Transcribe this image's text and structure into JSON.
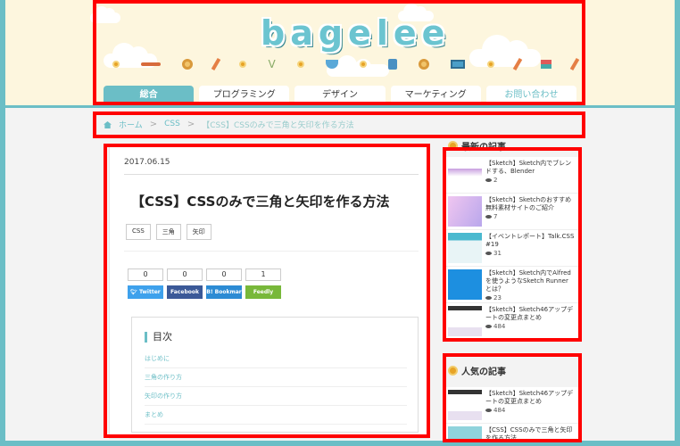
{
  "site": {
    "logo": "bagelee"
  },
  "nav": {
    "items": [
      {
        "label": "総合"
      },
      {
        "label": "プログラミング"
      },
      {
        "label": "デザイン"
      },
      {
        "label": "マーケティング"
      },
      {
        "label": "お問い合わせ"
      }
    ]
  },
  "breadcrumb": {
    "home": "ホーム",
    "category": "CSS",
    "current": "【CSS】CSSのみで三角と矢印を作る方法"
  },
  "article": {
    "date": "2017.06.15",
    "title": "【CSS】CSSのみで三角と矢印を作る方法",
    "tags": [
      "CSS",
      "三角",
      "矢印"
    ],
    "shares": [
      {
        "count": "0",
        "label": "Twitter"
      },
      {
        "count": "0",
        "label": "Facebook"
      },
      {
        "count": "0",
        "label": "B! Bookmar"
      },
      {
        "count": "1",
        "label": "Feedly"
      }
    ],
    "toc": {
      "title": "目次",
      "items": [
        "はじめに",
        "三角の作り方",
        "矢印の作り方",
        "まとめ"
      ]
    }
  },
  "sidebar": {
    "recent_title": "最新の記事",
    "recent": [
      {
        "title": "【Sketch】Sketch内でブレンドする、Blender",
        "views": "2"
      },
      {
        "title": "【Sketch】Sketchのおすすめ無料素材サイトのご紹介",
        "views": "7"
      },
      {
        "title": "【イベントレポート】Talk.CSS #19",
        "views": "31"
      },
      {
        "title": "【Sketch】Sketch内でAlfredを使うようなSketch Runner とは？",
        "views": "23"
      },
      {
        "title": "【Sketch】Sketch46アップデートの変更点まとめ",
        "views": "484"
      }
    ],
    "popular_title": "人気の記事",
    "popular": [
      {
        "title": "【Sketch】Sketch46アップデートの変更点まとめ",
        "views": "484"
      },
      {
        "title": "【CSS】CSSのみで三角と矢印を作る方法",
        "views": ""
      }
    ]
  }
}
